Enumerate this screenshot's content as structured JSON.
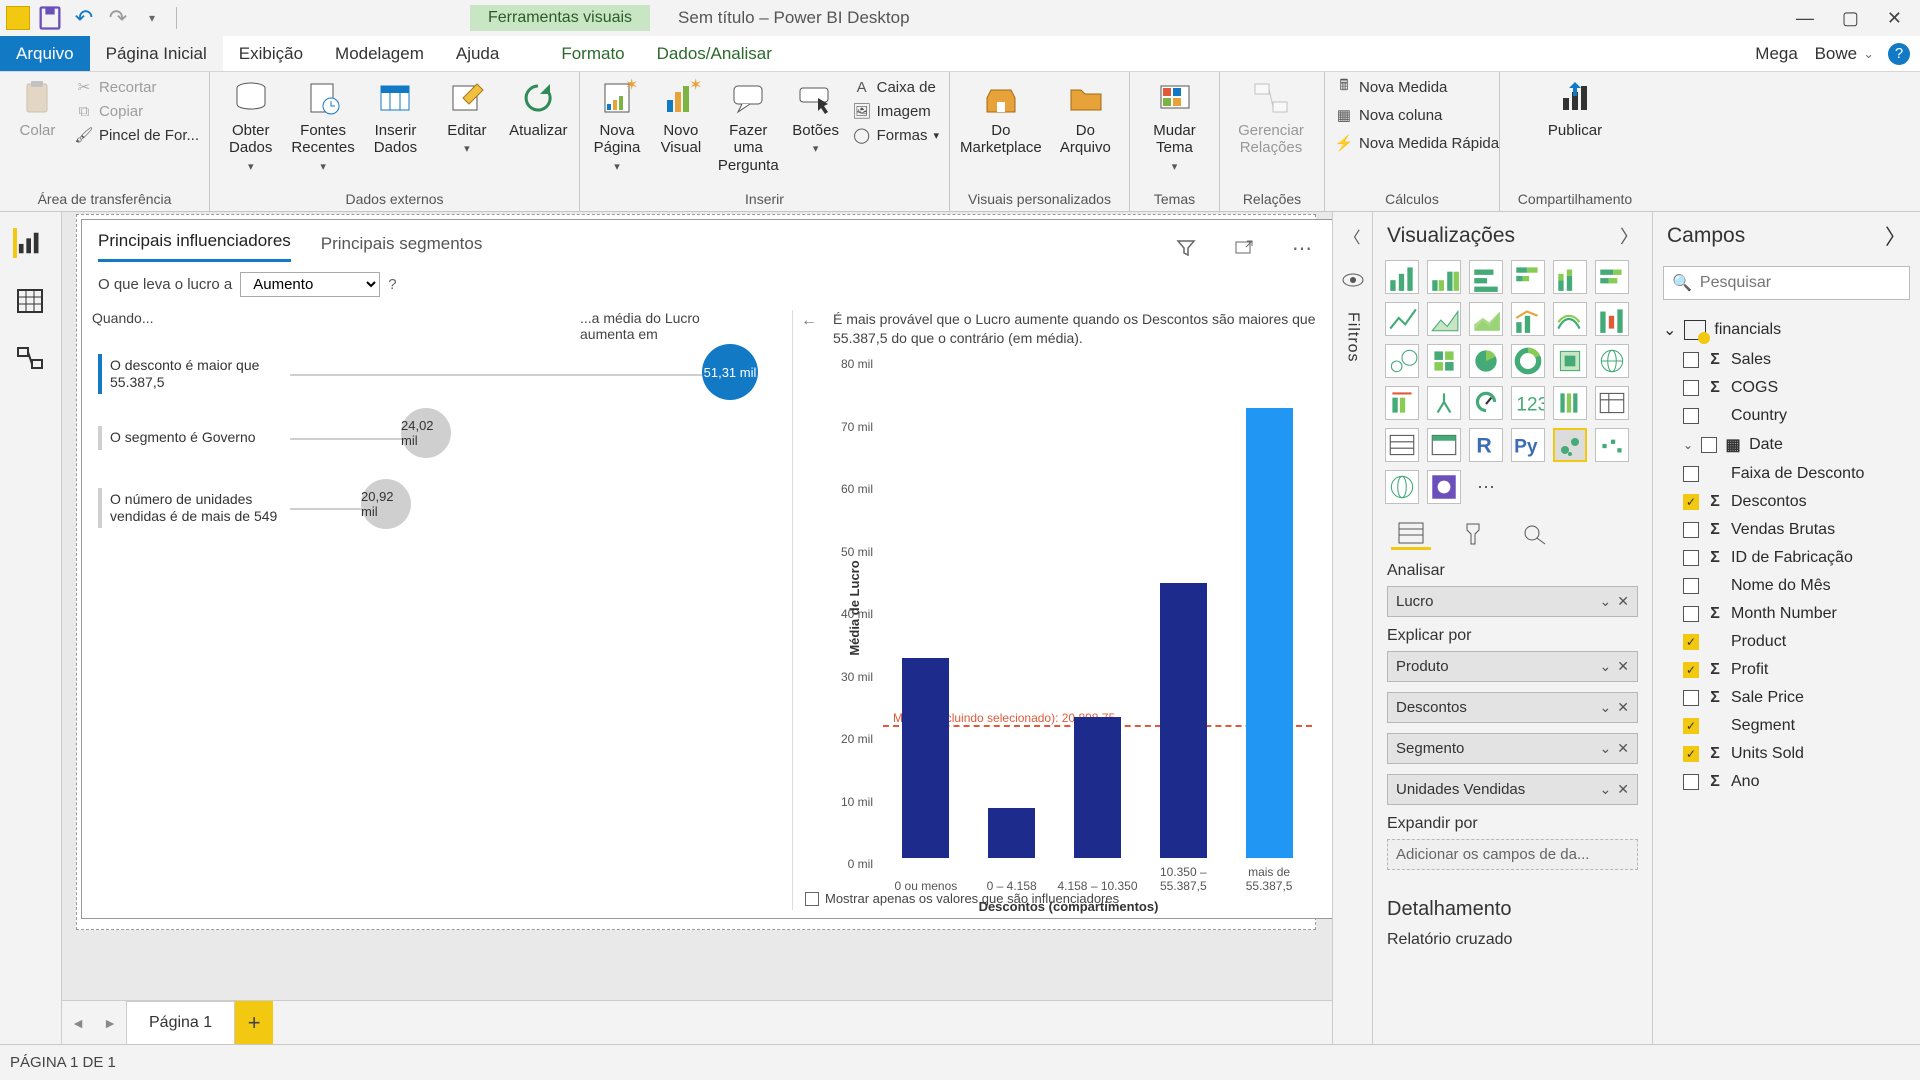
{
  "title": "Sem título – Power BI Desktop",
  "contextual_tab": "Ferramentas visuais",
  "user": {
    "first": "Mega",
    "last": "Bowe"
  },
  "ribbon_tabs": {
    "file": "Arquivo",
    "home": "Página Inicial",
    "view": "Exibição",
    "model": "Modelagem",
    "help": "Ajuda",
    "format": "Formato",
    "data": "Dados/Analisar"
  },
  "ribbon": {
    "clipboard": {
      "paste": "Colar",
      "cut": "Recortar",
      "copy": "Copiar",
      "fmtpainter": "Pincel de For...",
      "group": "Área de transferência"
    },
    "external": {
      "getdata": "Obter Dados",
      "recent": "Fontes Recentes",
      "enter": "Inserir Dados",
      "edit": "Editar",
      "refresh": "Atualizar",
      "group": "Dados externos"
    },
    "insert": {
      "newpage": "Nova Página",
      "newvisual": "Novo Visual",
      "ask": "Fazer uma Pergunta",
      "buttons": "Botões",
      "textbox": "Caixa de",
      "image": "Imagem",
      "shapes": "Formas",
      "group": "Inserir"
    },
    "custom": {
      "market": "Do Marketplace",
      "file": "Do Arquivo",
      "group": "Visuais personalizados"
    },
    "themes": {
      "switch": "Mudar Tema",
      "group": "Temas"
    },
    "relations": {
      "manage": "Gerenciar Relações",
      "group": "Relações"
    },
    "calc": {
      "measure": "Nova Medida",
      "column": "Nova coluna",
      "quick": "Nova Medida Rápida",
      "group": "Cálculos"
    },
    "share": {
      "publish": "Publicar",
      "group": "Compartilhamento"
    }
  },
  "page_tabs": {
    "p1": "Página 1"
  },
  "status": "PÁGINA 1 DE 1",
  "filters_rail": "Filtros",
  "viz": {
    "title": "Visualizações",
    "well_tabs": {
      "fields": "fields",
      "format": "format",
      "analytics": "analytics"
    },
    "analyze_label": "Analisar",
    "analyze_field": "Lucro",
    "explain_label": "Explicar por",
    "explain_fields": [
      "Produto",
      "Descontos",
      "Segmento",
      "Unidades Vendidas"
    ],
    "expand_label": "Expandir por",
    "expand_placeholder": "Adicionar os campos de da...",
    "drill_header": "Detalhamento",
    "cross_label": "Relatório cruzado"
  },
  "fields": {
    "title": "Campos",
    "search_placeholder": "Pesquisar",
    "table": "financials",
    "items": [
      {
        "name": "Sales",
        "sigma": true,
        "checked": false
      },
      {
        "name": "COGS",
        "sigma": true,
        "checked": false
      },
      {
        "name": "Country",
        "sigma": false,
        "checked": false
      },
      {
        "name": "Date",
        "sigma": false,
        "checked": false,
        "expandable": true
      },
      {
        "name": "Faixa de Desconto",
        "sigma": false,
        "checked": false,
        "sub": true
      },
      {
        "name": "Descontos",
        "sigma": true,
        "checked": true,
        "sub": true
      },
      {
        "name": "Vendas Brutas",
        "sigma": true,
        "checked": false,
        "sub": true
      },
      {
        "name": "ID de Fabricação",
        "sigma": true,
        "checked": false,
        "sub": true
      },
      {
        "name": "Nome do Mês",
        "sigma": false,
        "checked": false,
        "sub": true
      },
      {
        "name": "Month Number",
        "sigma": true,
        "checked": false,
        "sub": true
      },
      {
        "name": "Product",
        "sigma": false,
        "checked": true,
        "sub": true
      },
      {
        "name": "Profit",
        "sigma": true,
        "checked": true,
        "sub": true
      },
      {
        "name": "Sale Price",
        "sigma": true,
        "checked": false,
        "sub": true
      },
      {
        "name": "Segment",
        "sigma": false,
        "checked": true,
        "sub": true
      },
      {
        "name": "Units Sold",
        "sigma": true,
        "checked": true,
        "sub": true
      },
      {
        "name": "Ano",
        "sigma": true,
        "checked": false,
        "sub": true
      }
    ]
  },
  "visual": {
    "tab_infl": "Principais influenciadores",
    "tab_seg": "Principais segmentos",
    "question_prefix": "O que leva o lucro a",
    "question_value": "Aumento",
    "when_header": "Quando...",
    "effect_header": "...a média do Lucro aumenta em",
    "influencers": [
      {
        "label": "O desconto é maior que 55.387,5",
        "value": "51,31 mil",
        "selected": true,
        "size": 56,
        "offset": 430
      },
      {
        "label": "O segmento é Governo",
        "value": "24,02 mil",
        "selected": false,
        "size": 50,
        "offset": 142
      },
      {
        "label": "O número de unidades vendidas é de mais de 549",
        "value": "20,92 mil",
        "selected": false,
        "size": 50,
        "offset": 102
      }
    ],
    "caption": "É mais provável que o Lucro aumente quando os Descontos são maiores que 55.387,5 do que o contrário (em média).",
    "avg_line_label": "Média (excluindo selecionado): 20.898,75",
    "footer": "Mostrar apenas os valores que são influenciadores"
  },
  "chart_data": {
    "type": "bar",
    "ylabel": "Média de Lucro",
    "xlabel": "Descontos (compartimentos)",
    "ylim": [
      0,
      80000
    ],
    "yticks": [
      "0 mil",
      "10 mil",
      "20 mil",
      "30 mil",
      "40 mil",
      "50 mil",
      "60 mil",
      "70 mil",
      "80 mil"
    ],
    "categories": [
      "0 ou menos",
      "0 – 4.158",
      "4.158 – 10.350",
      "10.350 – 55.387,5",
      "mais de 55.387,5"
    ],
    "values": [
      32000,
      8000,
      22500,
      44000,
      72000
    ],
    "highlight_index": 4,
    "avg_excl_selected": 20898.75
  }
}
